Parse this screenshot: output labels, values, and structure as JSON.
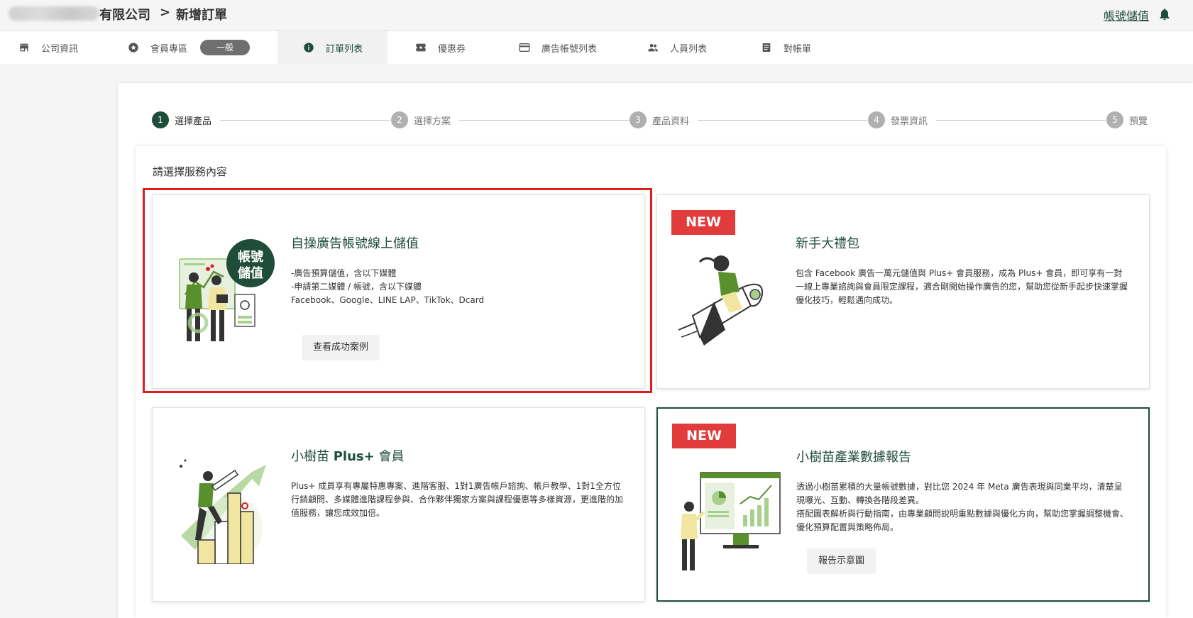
{
  "header": {
    "company_suffix": "有限公司",
    "separator": ">",
    "page": "新增訂單",
    "topup_link": "帳號儲值"
  },
  "tabs": [
    {
      "label": "公司資訊",
      "icon": "store-icon"
    },
    {
      "label": "會員專區",
      "icon": "star-badge-icon",
      "pill": "一般"
    },
    {
      "label": "訂單列表",
      "icon": "info-icon",
      "active": true
    },
    {
      "label": "優惠券",
      "icon": "ticket-icon"
    },
    {
      "label": "廣告帳號列表",
      "icon": "credit-card-icon"
    },
    {
      "label": "人員列表",
      "icon": "people-icon"
    },
    {
      "label": "對帳單",
      "icon": "document-icon"
    }
  ],
  "stepper": [
    {
      "num": "1",
      "label": "選擇產品",
      "active": true
    },
    {
      "num": "2",
      "label": "選擇方案"
    },
    {
      "num": "3",
      "label": "產品資料"
    },
    {
      "num": "4",
      "label": "發票資訊"
    },
    {
      "num": "5",
      "label": "預覽"
    }
  ],
  "section_title": "請選擇服務內容",
  "services": {
    "topup": {
      "title": "自操廣告帳號線上儲值",
      "badge_line1": "帳號",
      "badge_line2": "儲值",
      "lines": [
        "-廣告預算儲值，含以下媒體",
        "-申請第二媒體 / 帳號，含以下媒體",
        "Facebook、Google、LINE LAP、TikTok、Dcard"
      ],
      "button": "查看成功案例"
    },
    "starter": {
      "badge": "NEW",
      "title": "新手大禮包",
      "desc": "包含 Facebook 廣告一萬元儲值與 Plus+ 會員服務，成為 Plus+ 會員，即可享有一對一線上專業諮詢與會員限定課程，適合剛開始操作廣告的您，幫助您從新手起步快速掌握優化技巧，輕鬆邁向成功。"
    },
    "plus": {
      "title_prefix": "小樹苗 ",
      "title_bold": "Plus+",
      "title_suffix": " 會員",
      "desc": "Plus+ 成員享有專屬特惠專案、進階客服、1對1廣告帳戶諮詢、帳戶教學、1對1全方位行銷顧問、多媒體進階課程參與、合作夥伴獨家方案與課程優惠等多樣資源，更進階的加值服務，讓您成效加倍。"
    },
    "report": {
      "badge": "NEW",
      "title": "小樹苗產業數據報告",
      "desc1": "透過小樹苗累積的大量帳號數據，對比您 2024 年 Meta 廣告表現與同業平均，清楚呈現曝光、互動、轉換各階段差異。",
      "desc2": "搭配圖表解析與行動指南，由專業顧問說明重點數據與優化方向，幫助您掌握調整機會、優化預算配置與策略佈局。",
      "button": "報告示意圖"
    }
  },
  "colors": {
    "brand_green": "#1f4d3a",
    "accent_green": "#5a8f2e",
    "light_green": "#a8d08d",
    "new_red": "#e23b3b",
    "highlight_red": "#e01b1b"
  }
}
